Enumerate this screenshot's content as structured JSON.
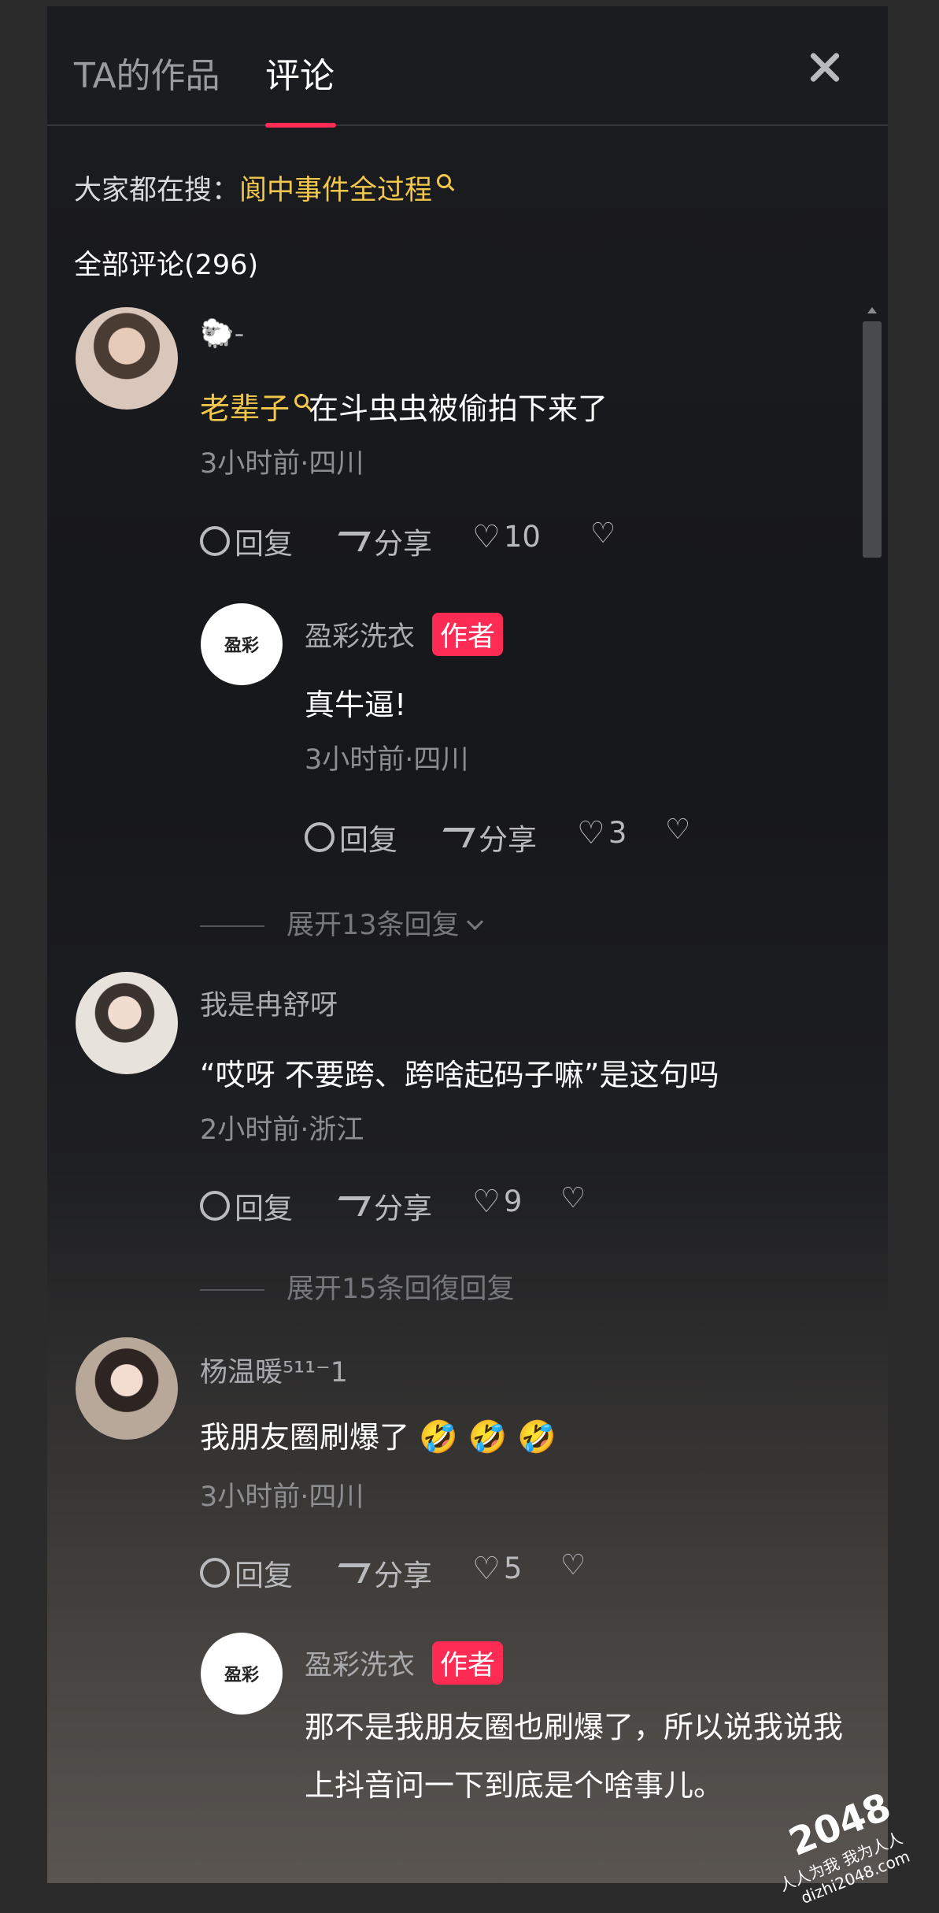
{
  "tabs": [
    {
      "label": "TA的作品",
      "active": false
    },
    {
      "label": "评论",
      "active": true
    }
  ],
  "hot_search": {
    "prefix": "大家都在搜：",
    "keyword": "阆中事件全过程"
  },
  "all_comments_label": "全部评论(296)",
  "comments": [
    {
      "user": "🐑-",
      "keyword": "老辈子",
      "text": "在斗虫虫被偷拍下来了",
      "meta": "3小时前·四川",
      "reply_label": "回复",
      "share_label": "分享",
      "likes": "10",
      "reply": {
        "user": "盈彩洗衣",
        "badge": "作者",
        "text": "真牛逼!",
        "meta": "3小时前·四川",
        "reply_label": "回复",
        "share_label": "分享",
        "likes": "3"
      },
      "expand_label": "展开13条回复"
    },
    {
      "user": "我是冉舒呀",
      "text": "“哎呀 不要跨、跨啥起码子嘛”是这句吗",
      "meta": "2小时前·浙江",
      "reply_label": "回复",
      "share_label": "分享",
      "likes": "9",
      "expand_label": "展开15条回復回复"
    },
    {
      "user": "杨温暖⁵¹¹⁻1",
      "text": "我朋友圈刷爆了",
      "emoji": "🤣 🤣 🤣",
      "meta": "3小时前·四川",
      "reply_label": "回复",
      "share_label": "分享",
      "likes": "5",
      "reply": {
        "user": "盈彩洗衣",
        "badge": "作者",
        "text": "那不是我朋友圈也刷爆了，所以说我说我上抖音问一下到底是个啥事儿。"
      }
    }
  ],
  "brand_avatar_text": "盈彩",
  "watermark": {
    "big": "2048",
    "line1": "人人为我 我为人人",
    "line2": "dizhi2048.com"
  }
}
